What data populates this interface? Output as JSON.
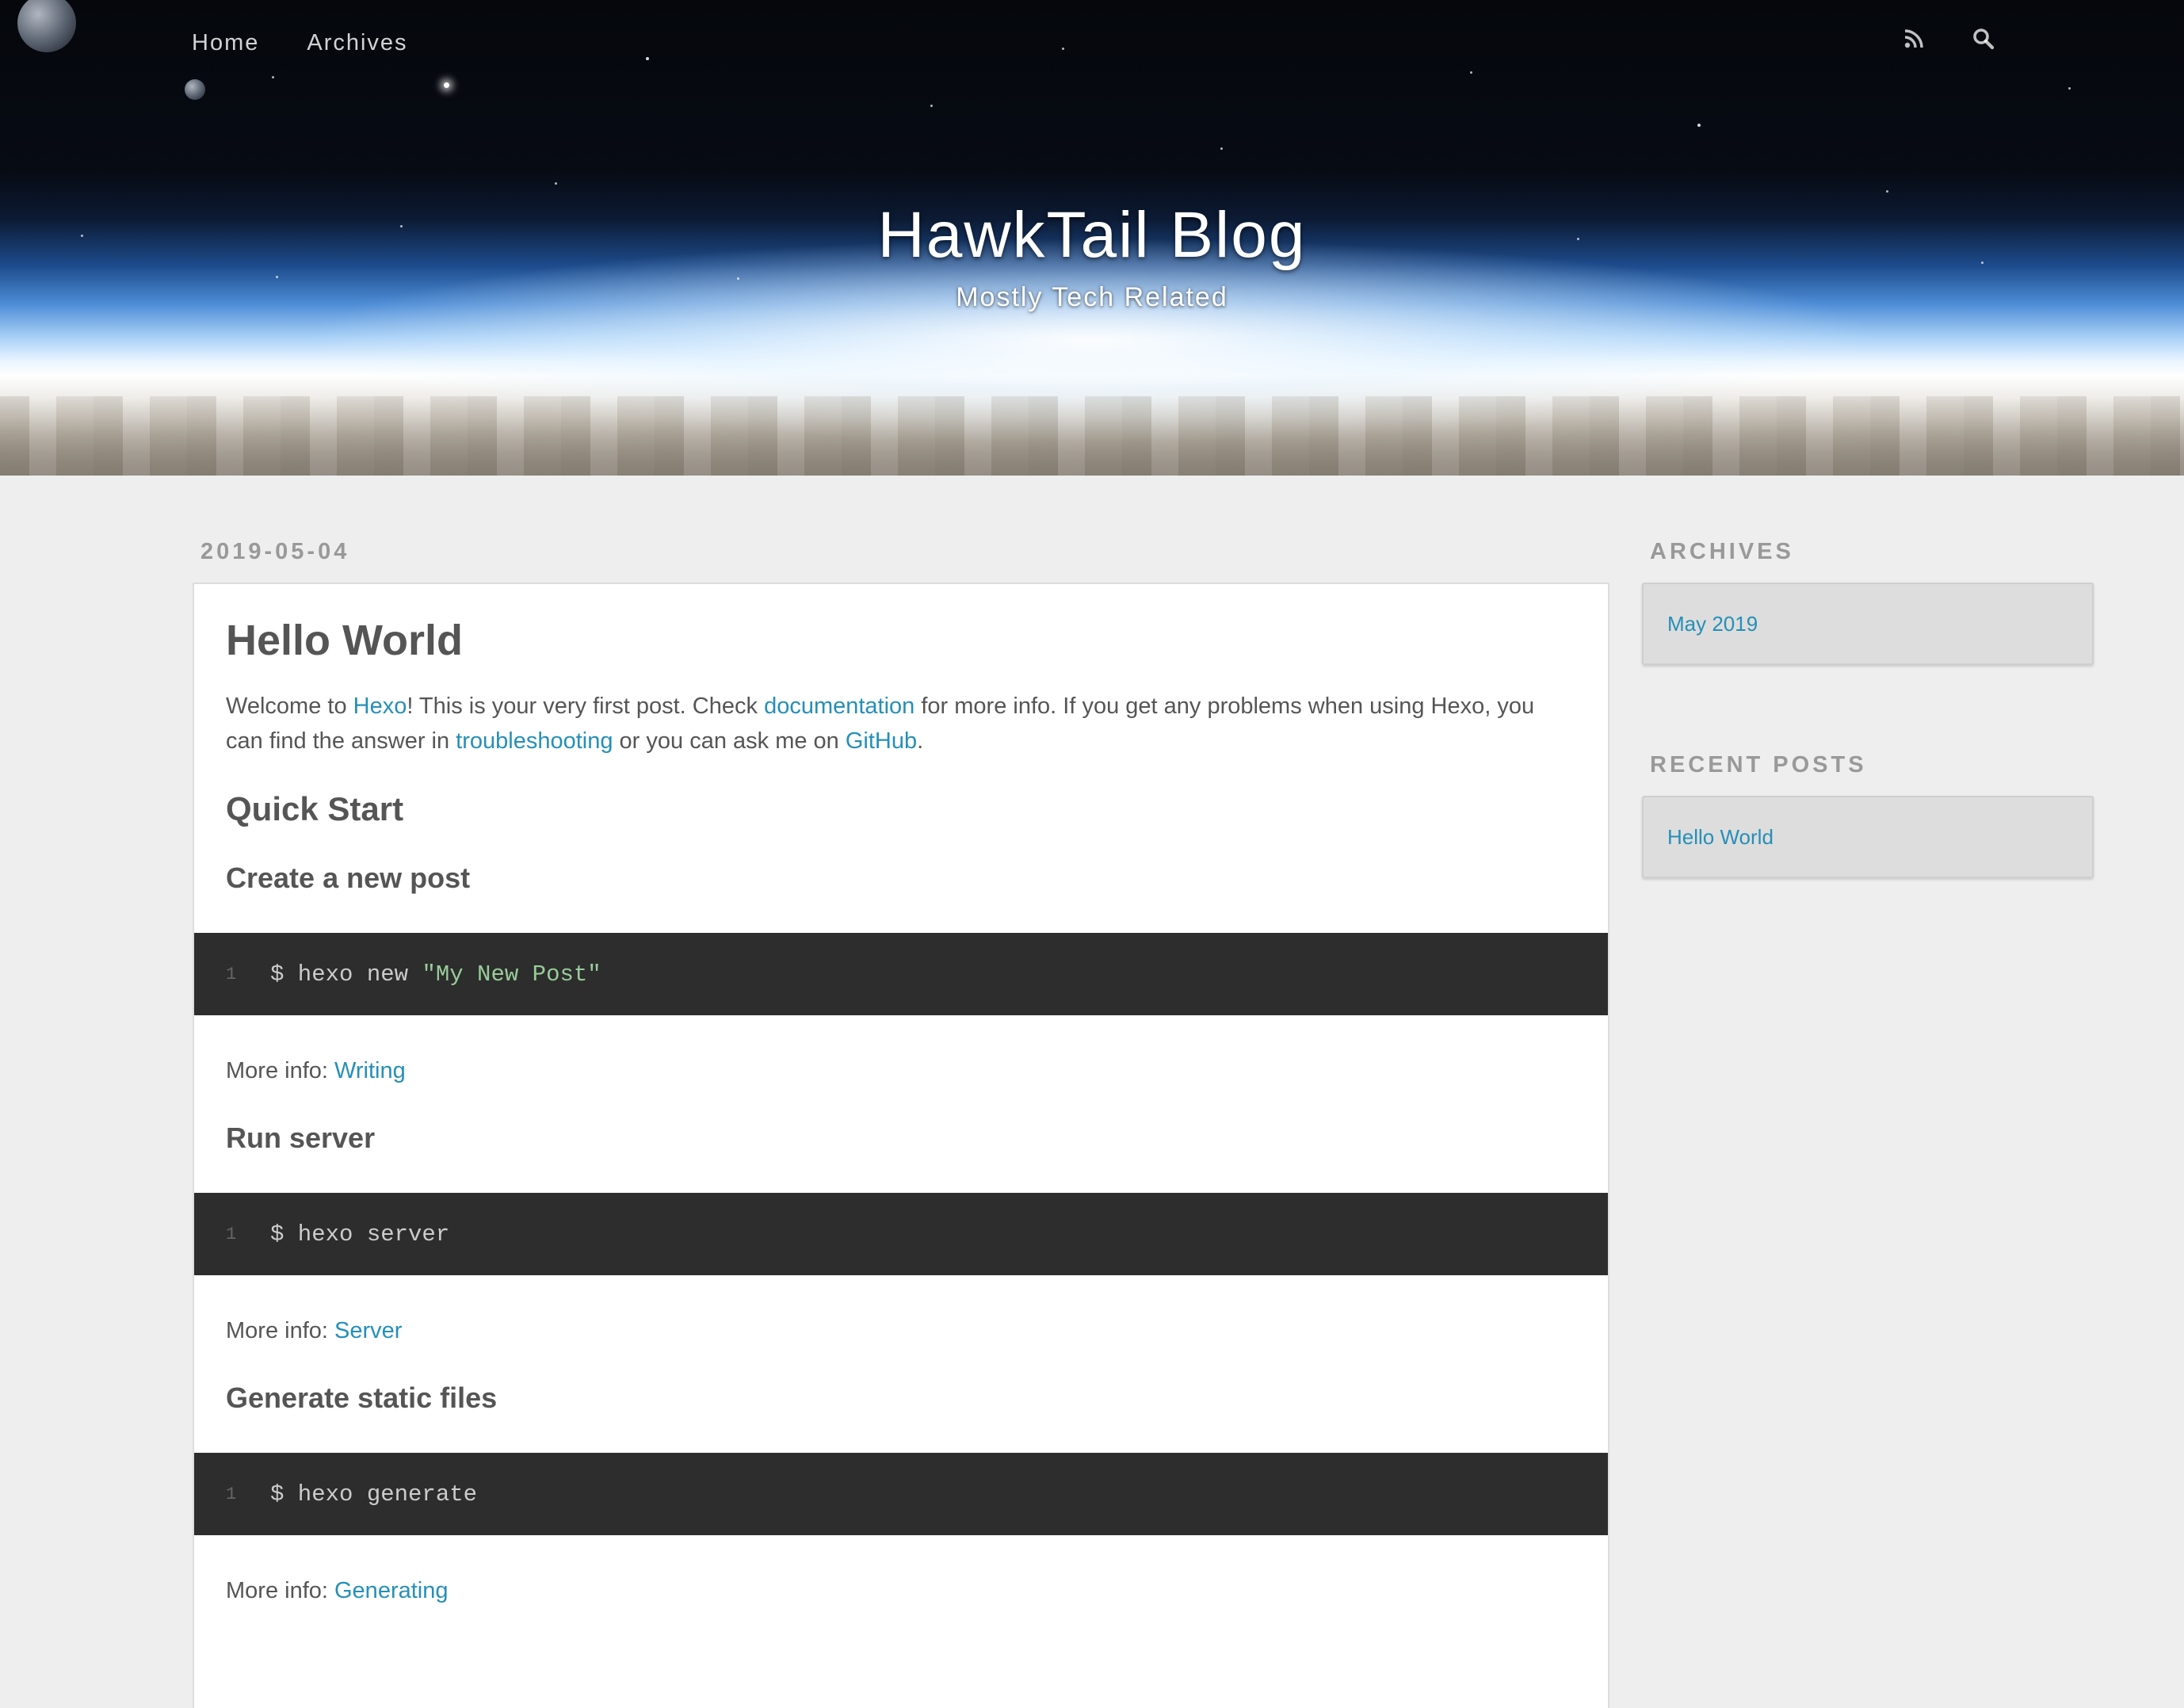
{
  "nav": {
    "items": [
      {
        "label": "Home"
      },
      {
        "label": "Archives"
      }
    ],
    "icons": [
      "rss-icon",
      "search-icon"
    ]
  },
  "site": {
    "title": "HawkTail Blog",
    "subtitle": "Mostly Tech Related"
  },
  "article": {
    "date": "2019-05-04",
    "title": "Hello World",
    "intro": {
      "t1": "Welcome to ",
      "link1": "Hexo",
      "t2": "! This is your very first post. Check ",
      "link2": "documentation",
      "t3": " for more info. If you get any problems when using Hexo, you can find the answer in ",
      "link3": "troubleshooting",
      "t4": " or you can ask me on ",
      "link4": "GitHub",
      "t5": "."
    },
    "quick_start": "Quick Start",
    "sections": [
      {
        "heading": "Create a new post",
        "line_no": "1",
        "command": "$ hexo new ",
        "string": "\"My New Post\"",
        "more_label": "More info: ",
        "more_link": "Writing"
      },
      {
        "heading": "Run server",
        "line_no": "1",
        "command": "$ hexo server",
        "more_label": "More info: ",
        "more_link": "Server"
      },
      {
        "heading": "Generate static files",
        "line_no": "1",
        "command": "$ hexo generate",
        "more_label": "More info: ",
        "more_link": "Generating"
      }
    ]
  },
  "sidebar": {
    "archives_title": "ARCHIVES",
    "archives_items": [
      "May 2019"
    ],
    "recent_title": "RECENT POSTS",
    "recent_items": [
      "Hello World"
    ]
  },
  "colors": {
    "link": "#258fb8",
    "background": "#eeeeee",
    "code_bg": "#2d2d2d",
    "code_string": "#99cc99"
  }
}
